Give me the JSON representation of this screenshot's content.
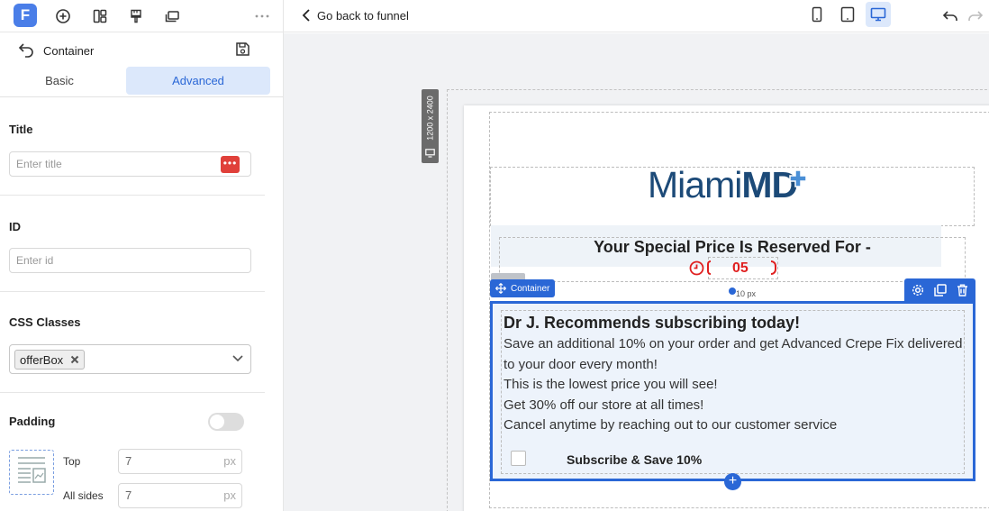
{
  "app": {
    "logo_letter": "F",
    "back_to_funnel": "Go back to funnel"
  },
  "sidebar": {
    "header_title": "Container",
    "tabs": [
      {
        "label": "Basic",
        "active": false
      },
      {
        "label": "Advanced",
        "active": true
      }
    ],
    "title_label": "Title",
    "title_placeholder": "Enter title",
    "title_more": "•••",
    "id_label": "ID",
    "id_placeholder": "Enter id",
    "css_label": "CSS Classes",
    "css_chip": "offerBox",
    "padding_label": "Padding",
    "padding_toggle": false,
    "top_label": "Top",
    "top_value": "7",
    "all_label": "All sides",
    "all_value": "7",
    "unit": "px"
  },
  "canvas": {
    "dims_label": "1200 x 2400",
    "brand_light": "Miami",
    "brand_bold": "MD",
    "special_heading": "Your Special Price Is Reserved For -",
    "timer_value": "05",
    "container_tag": "Container",
    "padding_hint": "10 px",
    "offer": {
      "headline": "Dr J. Recommends subscribing today!",
      "lines": [
        "Save an additional 10% on your order and get Advanced Crepe Fix delivered to your door every month!",
        "This is the lowest price you will see!",
        "Get 30% off our store at all times!",
        "Cancel anytime by reaching out to our customer service"
      ],
      "checkbox_label": "Subscribe & Save 10%"
    }
  },
  "colors": {
    "accent": "#2a67d6",
    "brand": "#1c4a78",
    "timer": "#e02020"
  }
}
